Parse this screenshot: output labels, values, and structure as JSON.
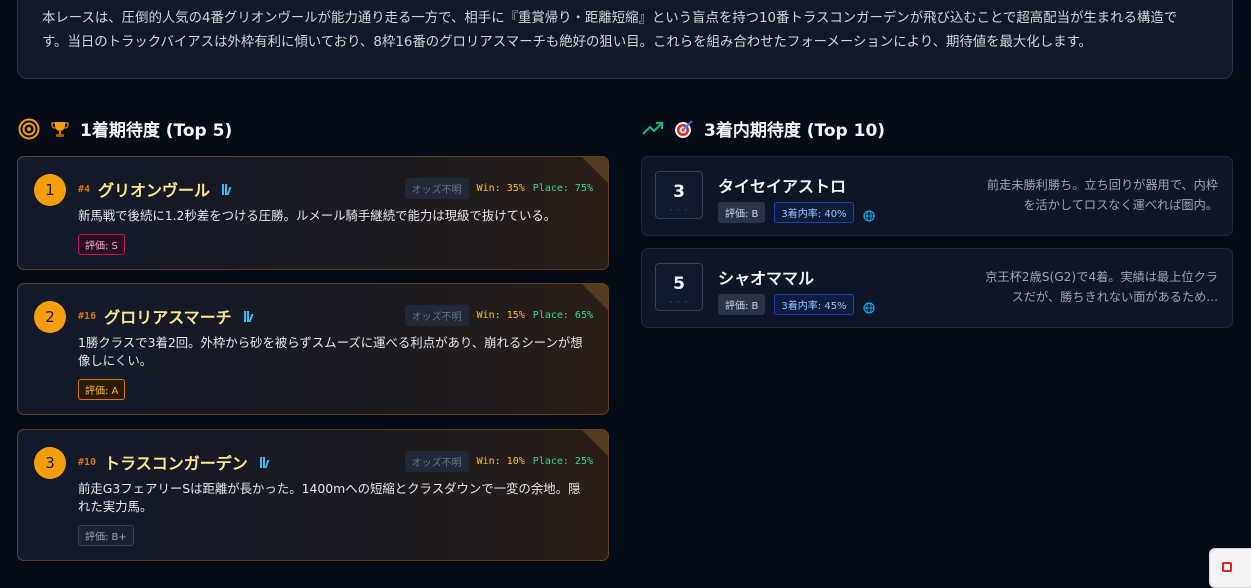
{
  "summary": {
    "line1": "本レースは、圧倒的人気の4番グリオンヴールが能力通り走る一方で、相手に『重賞帰り・距離短縮』という盲点を持つ10番トラスコンガーデンが飛び込むことで超高配当が生まれる構造で",
    "line2": "す。当日のトラックバイアスは外枠有利に傾いており、8枠16番のグロリアスマーチも絶好の狙い目。これらを組み合わせたフォーメーションにより、期待値を最大化します。"
  },
  "win_section": {
    "title": "1着期待度 (Top 5)",
    "icons": [
      "target-icon",
      "trophy-icon"
    ],
    "items": [
      {
        "rank": "1",
        "num": "#4",
        "name": "グリオンヴール",
        "odds": "オッズ不明",
        "win": "Win: 35%",
        "place": "Place: 75%",
        "desc": "新馬戦で後続に1.2秒差をつける圧勝。ルメール騎手継続で能力は現級で抜けている。",
        "grade": "評価: S"
      },
      {
        "rank": "2",
        "num": "#16",
        "name": "グロリアスマーチ",
        "odds": "オッズ不明",
        "win": "Win: 15%",
        "place": "Place: 65%",
        "desc": "1勝クラスで3着2回。外枠から砂を被らずスムーズに運べる利点があり、崩れるシーンが想像しにくい。",
        "grade": "評価: A"
      },
      {
        "rank": "3",
        "num": "#10",
        "name": "トラスコンガーデン",
        "odds": "オッズ不明",
        "win": "Win: 10%",
        "place": "Place: 25%",
        "desc": "前走G3フェアリーSは距離が長かった。1400mへの短縮とクラスダウンで一変の余地。隠れた実力馬。",
        "grade": "評価: B+"
      }
    ]
  },
  "place_section": {
    "title": "3着内期待度 (Top 10)",
    "icons": [
      "trending-up-icon",
      "dart-target-icon"
    ],
    "items": [
      {
        "num": "3",
        "dash": "- - -",
        "name": "タイセイアストロ",
        "eval": "評価: B",
        "rate": "3着内率: 40%",
        "comment": "前走未勝利勝ち。立ち回りが器用で、内枠を活かしてロスなく運べれば圏内。"
      },
      {
        "num": "5",
        "dash": "- - -",
        "name": "シャオママル",
        "eval": "評価: B",
        "rate": "3着内率: 45%",
        "comment": "京王杯2歳S(G2)で4着。実績は最上位クラスだが、勝ちきれない面があるため..."
      }
    ]
  },
  "colors": {
    "accent": "#f59e0b",
    "win": "#fbbf24",
    "place": "#34d399",
    "rate": "#93c5fd"
  }
}
